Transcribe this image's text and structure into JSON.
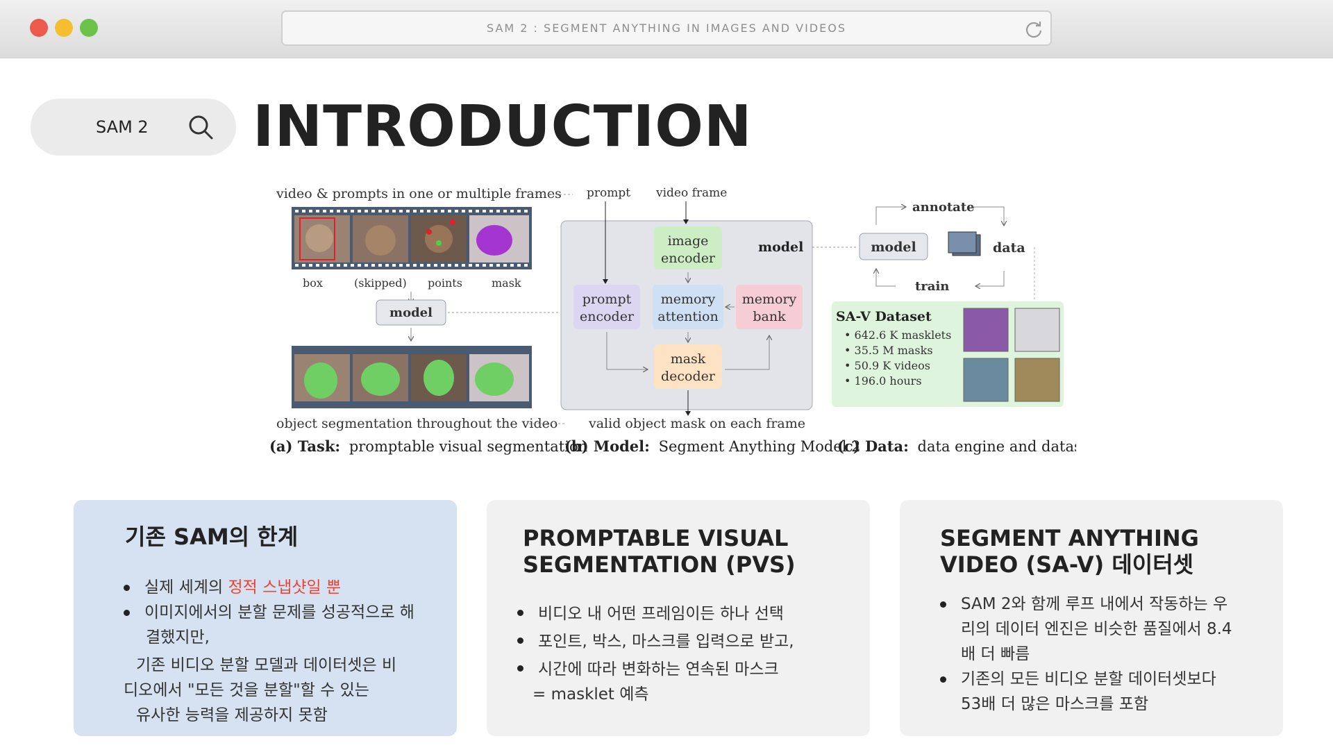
{
  "window": {
    "url_title": "SAM 2 : SEGMENT ANYTHING IN IMAGES AND VIDEOS",
    "reload_icon": "reload-icon"
  },
  "header": {
    "search_label": "SAM 2",
    "search_icon": "search-icon",
    "title": "INTRODUCTION"
  },
  "figure": {
    "task": {
      "top_label": "video & prompts in one or multiple frames",
      "frame_labels": [
        "box",
        "(skipped)",
        "points",
        "mask"
      ],
      "model_label": "model",
      "bottom_label": "object segmentation throughout the video",
      "caption_bold": "(a) Task:",
      "caption_rest": "promptable visual segmentation"
    },
    "model": {
      "prompt_label": "prompt",
      "video_frame_label": "video frame",
      "image_encoder": [
        "image",
        "encoder"
      ],
      "model_tag": "model",
      "prompt_encoder": [
        "prompt",
        "encoder"
      ],
      "memory_attention": [
        "memory",
        "attention"
      ],
      "memory_bank": [
        "memory",
        "bank"
      ],
      "mask_decoder": [
        "mask",
        "decoder"
      ],
      "output_label": "valid object mask on each frame",
      "caption_bold": "(b) Model:",
      "caption_rest": "Segment Anything Model 2"
    },
    "data": {
      "annotate": "annotate",
      "model_label": "model",
      "data_label": "data",
      "train": "train",
      "dataset_title": "SA-V Dataset",
      "stats": [
        "642.6 K masklets",
        "35.5 M masks",
        "50.9 K videos",
        "196.0 hours"
      ],
      "caption_bold": "(c) Data:",
      "caption_rest": "data engine and dataset"
    }
  },
  "cards": [
    {
      "title": "기존 SAM의 한계",
      "item1_plain": "실제 세계의 ",
      "item1_accent": "정적 스냅샷일 뿐",
      "item2_line1": "이미지에서의 분할 문제를 성공적으로 해",
      "item2_line2": "결했지만,",
      "extra_lines": [
        "기존 비디오 분할 모델과 데이터셋은 비",
        "디오에서 \"모든 것을 분할\"할 수 있는",
        "유사한 능력을 제공하지 못함"
      ],
      "accent_color": "#e8463a"
    },
    {
      "title_lines": [
        "PROMPTABLE VISUAL",
        "SEGMENTATION (PVS)"
      ],
      "items": [
        "비디오 내 어떤 프레임이든 하나 선택",
        "포인트, 박스, 마스크를 입력으로 받고,",
        "시간에 따라 변화하는 연속된 마스크"
      ],
      "extra_line": "= masklet 예측"
    },
    {
      "title_lines": [
        "SEGMENT ANYTHING",
        "VIDEO (SA-V) 데이터셋"
      ],
      "item1_lines": [
        "SAM 2와 함께 루프 내에서 작동하는 우",
        "리의 데이터 엔진은 비슷한 품질에서 8.4",
        "배 더 빠름"
      ],
      "item2_lines": [
        "기존의 모든 비디오 분할 데이터셋보다",
        "53배 더 많은 마스크를 포함"
      ]
    }
  ]
}
